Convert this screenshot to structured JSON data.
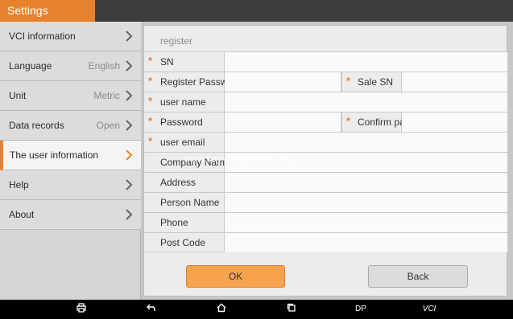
{
  "app": {
    "title": "Settings",
    "accent": "#e8822d"
  },
  "sidebar": {
    "items": [
      {
        "label": "VCI information",
        "value": ""
      },
      {
        "label": "Language",
        "value": "English"
      },
      {
        "label": "Unit",
        "value": "Metric"
      },
      {
        "label": "Data records",
        "value": "Open"
      },
      {
        "label": "The user information",
        "value": "",
        "active": true
      },
      {
        "label": "Help",
        "value": ""
      },
      {
        "label": "About",
        "value": ""
      }
    ]
  },
  "dialog": {
    "title": "register",
    "fields": [
      {
        "label": "SN",
        "required": true,
        "value": ""
      },
      {
        "label": "Register Passw",
        "required": true,
        "value": "",
        "second_label": "Sale SN",
        "second_required": true
      },
      {
        "label": "user name",
        "required": true,
        "value": ""
      },
      {
        "label": "Password",
        "required": true,
        "value": "",
        "second_label": "Confirm pa",
        "second_required": true
      },
      {
        "label": "user email",
        "required": true,
        "value": ""
      },
      {
        "label": "Company Nam",
        "required": false,
        "value": ""
      },
      {
        "label": "Address",
        "required": false,
        "value": ""
      },
      {
        "label": "Person Name",
        "required": false,
        "value": ""
      },
      {
        "label": "Phone",
        "required": false,
        "value": ""
      },
      {
        "label": "Post Code",
        "required": false,
        "value": ""
      }
    ],
    "ok_label": "OK",
    "back_label": "Back",
    "required_marker": "*"
  },
  "watermark": "www.key-programmer.org",
  "navbar": {
    "items": [
      {
        "icon": "printer-icon",
        "text": ""
      },
      {
        "icon": "back-arrow-icon",
        "text": ""
      },
      {
        "icon": "home-icon",
        "text": ""
      },
      {
        "icon": "recent-apps-icon",
        "text": ""
      },
      {
        "icon": "",
        "text": "DP"
      },
      {
        "icon": "",
        "text": "VCI"
      }
    ]
  }
}
